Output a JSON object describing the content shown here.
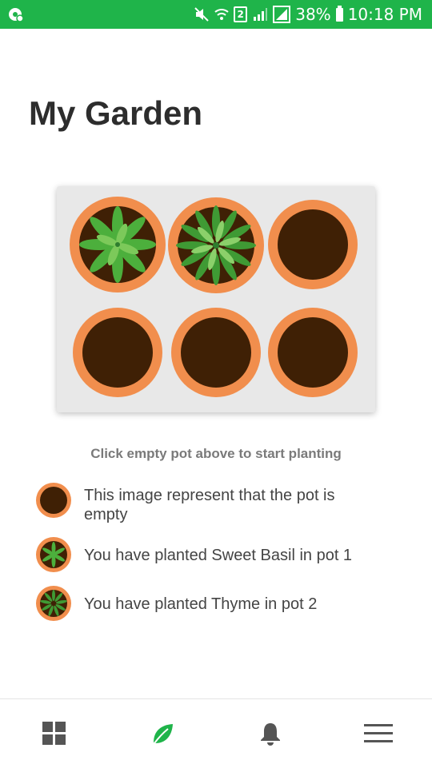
{
  "status_bar": {
    "battery": "38%",
    "time": "10:18 PM",
    "sim_badge": "2"
  },
  "page": {
    "title": "My Garden"
  },
  "garden": {
    "pots": [
      {
        "index": 1,
        "plant": "Sweet Basil"
      },
      {
        "index": 2,
        "plant": "Thyme"
      },
      {
        "index": 3,
        "plant": null
      },
      {
        "index": 4,
        "plant": null
      },
      {
        "index": 5,
        "plant": null
      },
      {
        "index": 6,
        "plant": null
      }
    ]
  },
  "hint": "Click empty pot above to start planting",
  "legend": [
    {
      "icon": "empty-pot-icon",
      "text": "This image represent that the pot is empty"
    },
    {
      "icon": "basil-pot-icon",
      "text": "You have planted Sweet Basil in pot 1"
    },
    {
      "icon": "thyme-pot-icon",
      "text": "You have planted Thyme in pot 2"
    }
  ],
  "bottom_nav": [
    {
      "icon": "grid-icon",
      "active": false
    },
    {
      "icon": "leaf-icon",
      "active": true
    },
    {
      "icon": "bell-icon",
      "active": false
    },
    {
      "icon": "menu-icon",
      "active": false
    }
  ],
  "colors": {
    "status_bar": "#1fb44a",
    "pot_rim": "#f18e4d",
    "soil": "#3f2005",
    "active_nav": "#1fb44a",
    "inactive_nav": "#555555"
  }
}
